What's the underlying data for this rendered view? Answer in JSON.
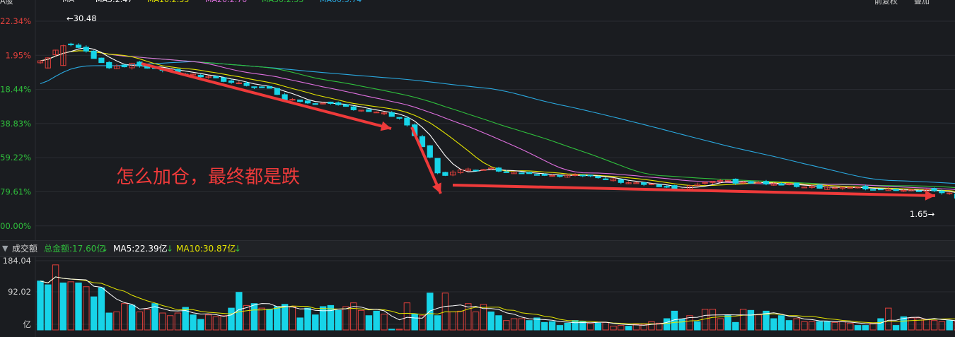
{
  "topbar": {
    "items": [
      "A股",
      "MA",
      "MA5:2.47",
      "MA10:2.33",
      "MA20:2.70",
      "MA30:2.33",
      "MA60:3.74"
    ],
    "right": [
      "前复权",
      "叠加"
    ],
    "colors": [
      "#cfcfcf",
      "#cfcfcf",
      "#ffffff",
      "#e6e600",
      "#e070e0",
      "#2fbf3c",
      "#2aa9e0"
    ]
  },
  "annotation": "怎么加仓，最终都是跌",
  "chart_data": [
    {
      "type": "candlestick",
      "y_scale": "log",
      "y_tick_labels": [
        "22.34%",
        "1.95%",
        "-18.44%",
        "-38.83%",
        "-59.22%",
        "-79.61%",
        "-100.00%"
      ],
      "y_tick_values": [
        22.34,
        1.95,
        -18.44,
        -38.83,
        -59.22,
        -79.61,
        -100.0
      ],
      "max_label": "30.48",
      "min_label": "1.65",
      "colors": {
        "up": "#e0403b",
        "down": "#17d4e8",
        "ma5": "#ffffff",
        "ma10": "#e6e600",
        "ma20": "#e070e0",
        "ma30": "#2fbf3c",
        "ma60": "#2aa9e0",
        "arrow": "#ee3a3a"
      }
    },
    {
      "type": "bar",
      "header": {
        "menu_icon": "chevron-down-icon",
        "title": "成交额",
        "total": "总金额:17.60亿",
        "ma5": "MA5:22.39亿",
        "ma10": "MA10:30.87亿"
      },
      "y_tick_labels": [
        "184.04",
        "92.02",
        "亿"
      ],
      "values": [
        130,
        120,
        173,
        125,
        128,
        125,
        115,
        88,
        112,
        45,
        48,
        70,
        66,
        48,
        55,
        70,
        45,
        38,
        45,
        60,
        40,
        28,
        40,
        35,
        38,
        58,
        100,
        65,
        70,
        58,
        55,
        62,
        68,
        62,
        32,
        58,
        40,
        62,
        65,
        52,
        62,
        72,
        52,
        38,
        50,
        42,
        2,
        2,
        72,
        42,
        38,
        98,
        38,
        98,
        48,
        50,
        70,
        48,
        68,
        48,
        38,
        25,
        30,
        30,
        25,
        32,
        20,
        22,
        12,
        18,
        25,
        22,
        18,
        18,
        20,
        10,
        12,
        10,
        15,
        15,
        22,
        18,
        30,
        50,
        28,
        38,
        22,
        55,
        55,
        30,
        40,
        20,
        55,
        52,
        40,
        50,
        30,
        38,
        25,
        30,
        22,
        22,
        22,
        22,
        20,
        22,
        18,
        12,
        12,
        18,
        30,
        58,
        12,
        35,
        32,
        32,
        28,
        25,
        22,
        25,
        22,
        22
      ]
    }
  ]
}
